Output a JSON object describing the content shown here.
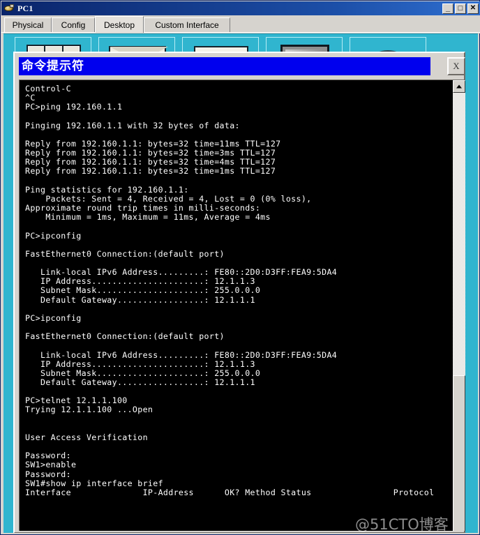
{
  "window": {
    "title": "PC1",
    "icon": "device-icon",
    "controls": {
      "minimize": "_",
      "maximize": "□",
      "close": "✕"
    }
  },
  "tabs": [
    {
      "label": "Physical",
      "active": false
    },
    {
      "label": "Config",
      "active": false
    },
    {
      "label": "Desktop",
      "active": true
    },
    {
      "label": "Custom Interface",
      "active": false
    }
  ],
  "desktop": {
    "icons": [
      {
        "name": "ip-configuration",
        "art": "windows"
      },
      {
        "name": "email",
        "art": "envelope"
      },
      {
        "name": "text-editor",
        "art": "document"
      },
      {
        "name": "terminal",
        "art": "monitor"
      },
      {
        "name": "web-browser",
        "art": "cloud"
      }
    ]
  },
  "command_prompt": {
    "title": "命令提示符",
    "close_label": "X",
    "terminal_text": "Control-C\n^C\nPC>ping 192.160.1.1\n\nPinging 192.160.1.1 with 32 bytes of data:\n\nReply from 192.160.1.1: bytes=32 time=11ms TTL=127\nReply from 192.160.1.1: bytes=32 time=3ms TTL=127\nReply from 192.160.1.1: bytes=32 time=4ms TTL=127\nReply from 192.160.1.1: bytes=32 time=1ms TTL=127\n\nPing statistics for 192.160.1.1:\n    Packets: Sent = 4, Received = 4, Lost = 0 (0% loss),\nApproximate round trip times in milli-seconds:\n    Minimum = 1ms, Maximum = 11ms, Average = 4ms\n\nPC>ipconfig\n\nFastEthernet0 Connection:(default port)\n\n   Link-local IPv6 Address.........: FE80::2D0:D3FF:FEA9:5DA4\n   IP Address......................: 12.1.1.3\n   Subnet Mask.....................: 255.0.0.0\n   Default Gateway.................: 12.1.1.1\n\nPC>ipconfig\n\nFastEthernet0 Connection:(default port)\n\n   Link-local IPv6 Address.........: FE80::2D0:D3FF:FEA9:5DA4\n   IP Address......................: 12.1.1.3\n   Subnet Mask.....................: 255.0.0.0\n   Default Gateway.................: 12.1.1.1\n\nPC>telnet 12.1.1.100\nTrying 12.1.1.100 ...Open\n\n\nUser Access Verification\n\nPassword:\nSW1>enable\nPassword:\nSW1#show ip interface brief\nInterface              IP-Address      OK? Method Status                Protocol",
    "scrollbar": {
      "up_arrow": "scroll-up-arrow"
    }
  },
  "watermark": {
    "text": "@51CTO博客"
  }
}
